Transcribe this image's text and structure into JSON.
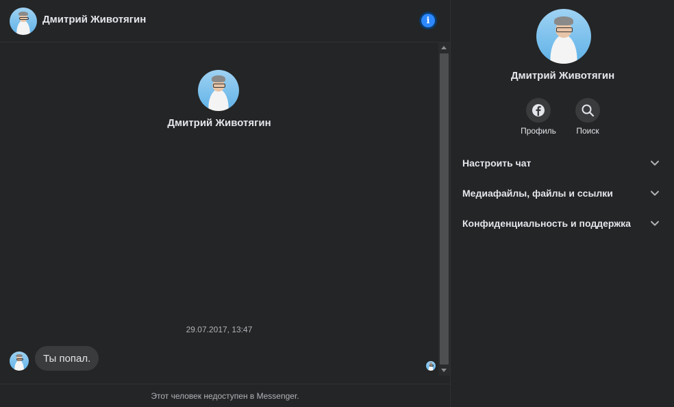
{
  "chat": {
    "contact_name": "Дмитрий Животягин",
    "intro_name": "Дмитрий Животягин",
    "timestamp": "29.07.2017, 13:47",
    "messages": [
      {
        "text": "Ты попал."
      }
    ],
    "footer_notice": "Этот человек недоступен в Messenger."
  },
  "info_icon": {
    "glyph": "i",
    "icon": "info-icon",
    "color": "#2d88ff"
  },
  "sidebar": {
    "name": "Дмитрий Животягин",
    "actions": [
      {
        "label": "Профиль",
        "icon": "facebook-icon"
      },
      {
        "label": "Поиск",
        "icon": "search-icon"
      }
    ],
    "sections": [
      {
        "label": "Настроить чат"
      },
      {
        "label": "Медиафайлы, файлы и ссылки"
      },
      {
        "label": "Конфиденциальность и поддержка"
      }
    ]
  },
  "colors": {
    "background": "#242526",
    "bubble": "#3a3b3c",
    "accent": "#2d88ff",
    "text_primary": "#e4e6eb",
    "text_secondary": "#b0b3b8"
  }
}
